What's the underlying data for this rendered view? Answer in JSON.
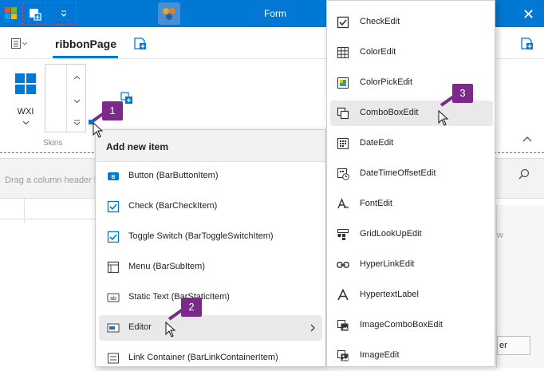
{
  "window": {
    "title": "Form"
  },
  "ribbon": {
    "active_tab": "ribbonPage",
    "skin_button_label": "WXI",
    "group_label": "Skins"
  },
  "grid": {
    "group_hint": "Drag a column header h",
    "side_fragment": "w",
    "button_fragment": "er"
  },
  "context_menu": {
    "header": "Add new item",
    "items": [
      {
        "label": "Button (BarButtonItem)",
        "icon": "button-icon"
      },
      {
        "label": "Check (BarCheckItem)",
        "icon": "checkbox-icon"
      },
      {
        "label": "Toggle Switch (BarToggleSwitchItem)",
        "icon": "checkbox-icon"
      },
      {
        "label": "Menu (BarSubItem)",
        "icon": "submenu-icon"
      },
      {
        "label": "Static Text (BarStaticItem)",
        "icon": "static-text-icon"
      },
      {
        "label": "Editor",
        "icon": "editor-icon",
        "has_submenu": true
      },
      {
        "label": "Link Container (BarLinkContainerItem)",
        "icon": "link-container-icon"
      }
    ]
  },
  "editor_submenu": {
    "items": [
      {
        "label": "CheckEdit",
        "icon": "checkbox-icon"
      },
      {
        "label": "ColorEdit",
        "icon": "color-grid-icon"
      },
      {
        "label": "ColorPickEdit",
        "icon": "color-pick-icon"
      },
      {
        "label": "ComboBoxEdit",
        "icon": "combobox-icon"
      },
      {
        "label": "DateEdit",
        "icon": "calendar-icon"
      },
      {
        "label": "DateTimeOffsetEdit",
        "icon": "calendar-clock-icon"
      },
      {
        "label": "FontEdit",
        "icon": "font-icon"
      },
      {
        "label": "GridLookUpEdit",
        "icon": "grid-lookup-icon"
      },
      {
        "label": "HyperLinkEdit",
        "icon": "hyperlink-icon"
      },
      {
        "label": "HypertextLabel",
        "icon": "hypertext-icon"
      },
      {
        "label": "ImageComboBoxEdit",
        "icon": "image-combobox-icon"
      },
      {
        "label": "ImageEdit",
        "icon": "image-icon"
      }
    ]
  },
  "callouts": [
    "1",
    "2",
    "3"
  ],
  "colors": {
    "accent": "#0078d4",
    "callout": "#7b2a8a",
    "designer_dash": "#e04060"
  }
}
